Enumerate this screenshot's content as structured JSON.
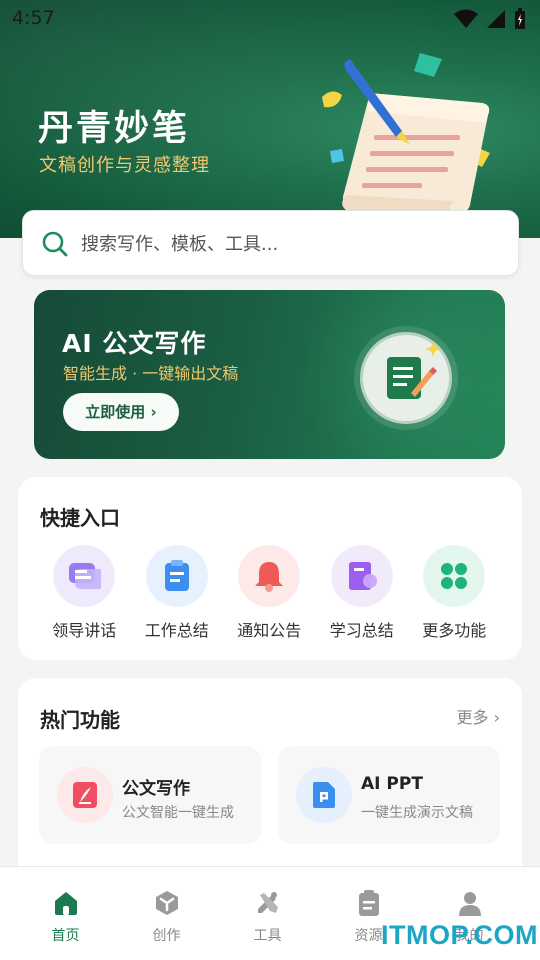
{
  "status_bar": {
    "time": "4:57"
  },
  "header": {
    "title": "丹青妙笔",
    "subtitle": "文稿创作与灵感整理"
  },
  "search": {
    "placeholder": "搜索写作、模板、工具..."
  },
  "banner": {
    "title": "AI 公文写作",
    "subtitle": "智能生成 · 一键输出文稿",
    "button": "立即使用 ›"
  },
  "quick_entry": {
    "title": "快捷入口",
    "items": [
      {
        "label": "领导讲话",
        "icon": "speech-bubble-icon"
      },
      {
        "label": "工作总结",
        "icon": "clipboard-icon"
      },
      {
        "label": "通知公告",
        "icon": "bell-icon"
      },
      {
        "label": "学习总结",
        "icon": "book-icon"
      },
      {
        "label": "更多功能",
        "icon": "clover-grid-icon"
      }
    ]
  },
  "hot_features": {
    "title": "热门功能",
    "more": "更多 ›",
    "items": [
      {
        "name": "公文写作",
        "desc": "公文智能一键生成",
        "icon": "pen-doc-icon"
      },
      {
        "name": "AI PPT",
        "desc": "一键生成演示文稿",
        "icon": "ppt-doc-icon"
      }
    ]
  },
  "bottom_nav": {
    "items": [
      {
        "label": "首页",
        "icon": "home-icon",
        "active": true
      },
      {
        "label": "创作",
        "icon": "cube-icon"
      },
      {
        "label": "工具",
        "icon": "tools-icon"
      },
      {
        "label": "资源",
        "icon": "clipboard-list-icon"
      },
      {
        "label": "我的",
        "icon": "user-icon"
      }
    ]
  },
  "watermark": "ITMOP.COM",
  "colors": {
    "brand_green": "#1b7a50",
    "header_green": "#135a3b",
    "accent_gold": "#f3c86d"
  }
}
